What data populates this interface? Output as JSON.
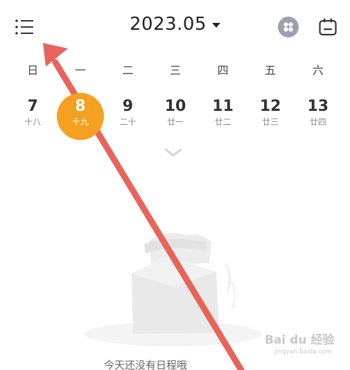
{
  "header": {
    "title": "2023.05",
    "menu_icon": "list-menu-icon",
    "apps_icon": "four-dots-icon",
    "calendar_icon": "calendar-icon"
  },
  "weekdays": [
    "日",
    "一",
    "二",
    "三",
    "四",
    "五",
    "六"
  ],
  "week": [
    {
      "day": "7",
      "lunar": "十八"
    },
    {
      "day": "8",
      "lunar": "十九",
      "selected": true
    },
    {
      "day": "9",
      "lunar": "二十"
    },
    {
      "day": "10",
      "lunar": "廿一"
    },
    {
      "day": "11",
      "lunar": "廿二"
    },
    {
      "day": "12",
      "lunar": "廿三"
    },
    {
      "day": "13",
      "lunar": "廿四"
    }
  ],
  "colors": {
    "selected": "#f5a020",
    "arrow": "#e8635a",
    "apps_button": "#9aa0ae"
  },
  "empty_state": {
    "text": "今天还没有日程哦"
  },
  "watermark": {
    "logo": "Bai du 经验",
    "url": "jingyan.baidu.com"
  }
}
